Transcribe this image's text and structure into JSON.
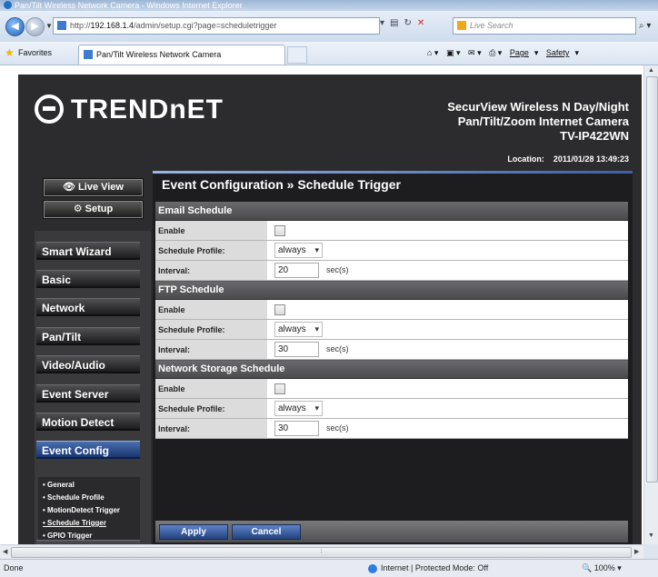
{
  "window": {
    "title": "Pan/Tilt Wireless Network Camera - Windows Internet Explorer"
  },
  "address": {
    "url_prefix": "http://",
    "url_host": "192.168.1.4",
    "url_path": "/admin/setup.cgi?page=scheduletrigger",
    "search_placeholder": "Live Search"
  },
  "favorites": {
    "label": "Favorites",
    "tab_title": "Pan/Tilt Wireless Network Camera"
  },
  "commandbar": {
    "page": "Page",
    "safety": "Safety"
  },
  "header": {
    "brand": "TRENDnET",
    "product_line1": "SecurView Wireless N Day/Night",
    "product_line2": "Pan/Tilt/Zoom Internet Camera",
    "model": "TV-IP422WN",
    "location_label": "Location:",
    "datetime": "2011/01/28 13:49:23"
  },
  "sidebar": {
    "live_view": "Live View",
    "setup": "Setup",
    "items": [
      {
        "label": "Smart Wizard"
      },
      {
        "label": "Basic"
      },
      {
        "label": "Network"
      },
      {
        "label": "Pan/Tilt"
      },
      {
        "label": "Video/Audio"
      },
      {
        "label": "Event Server"
      },
      {
        "label": "Motion Detect"
      },
      {
        "label": "Event Config"
      }
    ],
    "subitems": [
      {
        "label": "General"
      },
      {
        "label": "Schedule Profile"
      },
      {
        "label": "MotionDetect Trigger"
      },
      {
        "label": "Schedule Trigger"
      },
      {
        "label": "GPIO Trigger"
      }
    ]
  },
  "main": {
    "title": "Event Configuration » Schedule Trigger",
    "sections": [
      {
        "heading": "Email Schedule",
        "enable_label": "Enable",
        "profile_label": "Schedule Profile:",
        "profile_value": "always",
        "interval_label": "Interval:",
        "interval_value": "20",
        "interval_unit": "sec(s)"
      },
      {
        "heading": "FTP Schedule",
        "enable_label": "Enable",
        "profile_label": "Schedule Profile:",
        "profile_value": "always",
        "interval_label": "Interval:",
        "interval_value": "30",
        "interval_unit": "sec(s)"
      },
      {
        "heading": "Network Storage Schedule",
        "enable_label": "Enable",
        "profile_label": "Schedule Profile:",
        "profile_value": "always",
        "interval_label": "Interval:",
        "interval_value": "30",
        "interval_unit": "sec(s)"
      }
    ],
    "apply_label": "Apply",
    "cancel_label": "Cancel"
  },
  "status": {
    "left": "Done",
    "zone": "Internet | Protected Mode: Off",
    "zoom": "100%"
  }
}
